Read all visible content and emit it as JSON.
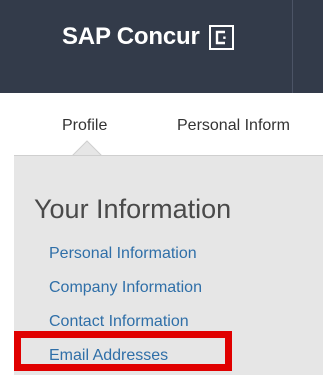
{
  "header": {
    "brand_text": "SAP Concur",
    "brand_icon": "concur-c-logo-icon"
  },
  "tabs": {
    "profile": "Profile",
    "personal_information": "Personal Inform"
  },
  "sidebar": {
    "title": "Your Information",
    "links": [
      "Personal Information",
      "Company Information",
      "Contact Information",
      "Email Addresses"
    ]
  },
  "colors": {
    "header_bg": "#333b4a",
    "link": "#2f6fa8",
    "highlight": "#e00000",
    "panel_bg": "#e6e6e6"
  }
}
